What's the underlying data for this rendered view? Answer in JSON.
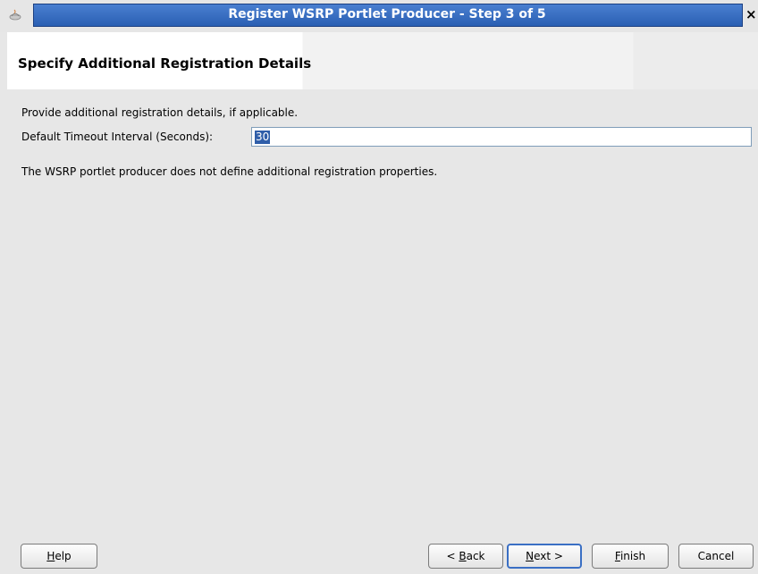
{
  "window": {
    "title": "Register WSRP Portlet Producer - Step 3 of 5",
    "close_glyph": "×",
    "app_icon": "java-cup-icon"
  },
  "header": {
    "heading": "Specify Additional Registration Details"
  },
  "content": {
    "intro": "Provide additional registration details, if applicable.",
    "timeout_label": "Default Timeout Interval (Seconds):",
    "timeout_value": "30",
    "note": "The WSRP portlet producer does not define additional registration properties."
  },
  "footer": {
    "help": {
      "mnemonic": "H",
      "rest": "elp"
    },
    "back": {
      "prefix": "< ",
      "mnemonic": "B",
      "rest": "ack"
    },
    "next": {
      "mnemonic": "N",
      "rest": "ext >"
    },
    "finish": {
      "mnemonic": "F",
      "rest": "inish"
    },
    "cancel": "Cancel"
  },
  "colors": {
    "title_bar": "#2a5fb3",
    "dialog_bg": "#e7e7e7",
    "selection": "#2f5ea9"
  }
}
